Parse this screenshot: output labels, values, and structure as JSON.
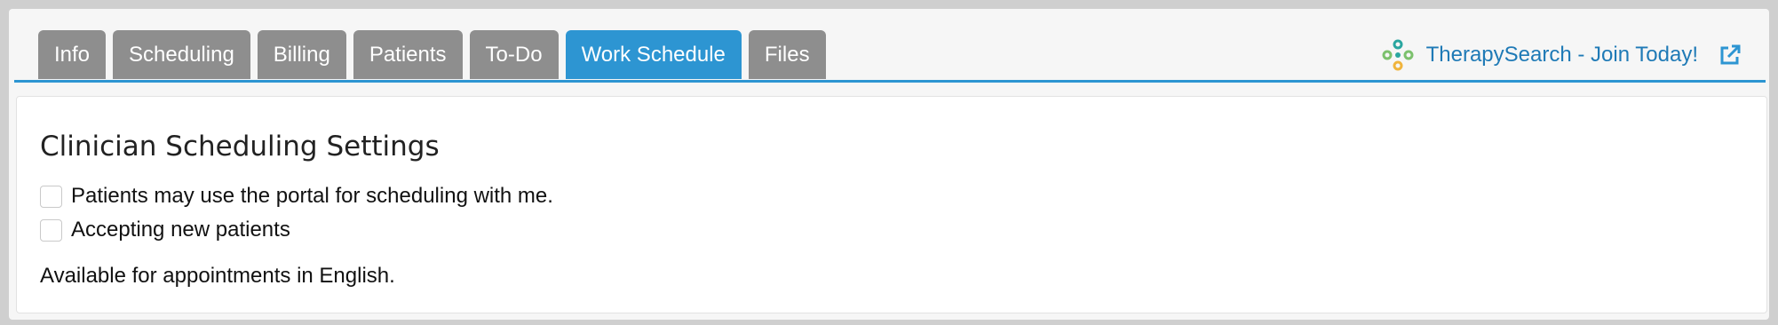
{
  "tabs": [
    {
      "label": "Info",
      "active": false
    },
    {
      "label": "Scheduling",
      "active": false
    },
    {
      "label": "Billing",
      "active": false
    },
    {
      "label": "Patients",
      "active": false
    },
    {
      "label": "To-Do",
      "active": false
    },
    {
      "label": "Work Schedule",
      "active": true
    },
    {
      "label": "Files",
      "active": false
    }
  ],
  "promo": {
    "logo_icon": "therapysearch-logo-icon",
    "label": "TherapySearch - Join Today!",
    "external_icon": "external-link-icon"
  },
  "settings": {
    "title": "Clinician Scheduling Settings",
    "options": [
      {
        "label": "Patients may use the portal for scheduling with me.",
        "checked": false
      },
      {
        "label": "Accepting new patients",
        "checked": false
      }
    ],
    "availability": "Available for appointments in English."
  },
  "colors": {
    "accent": "#2d95d2",
    "tab_inactive": "#8e8e8e",
    "link": "#1f7ab6"
  }
}
